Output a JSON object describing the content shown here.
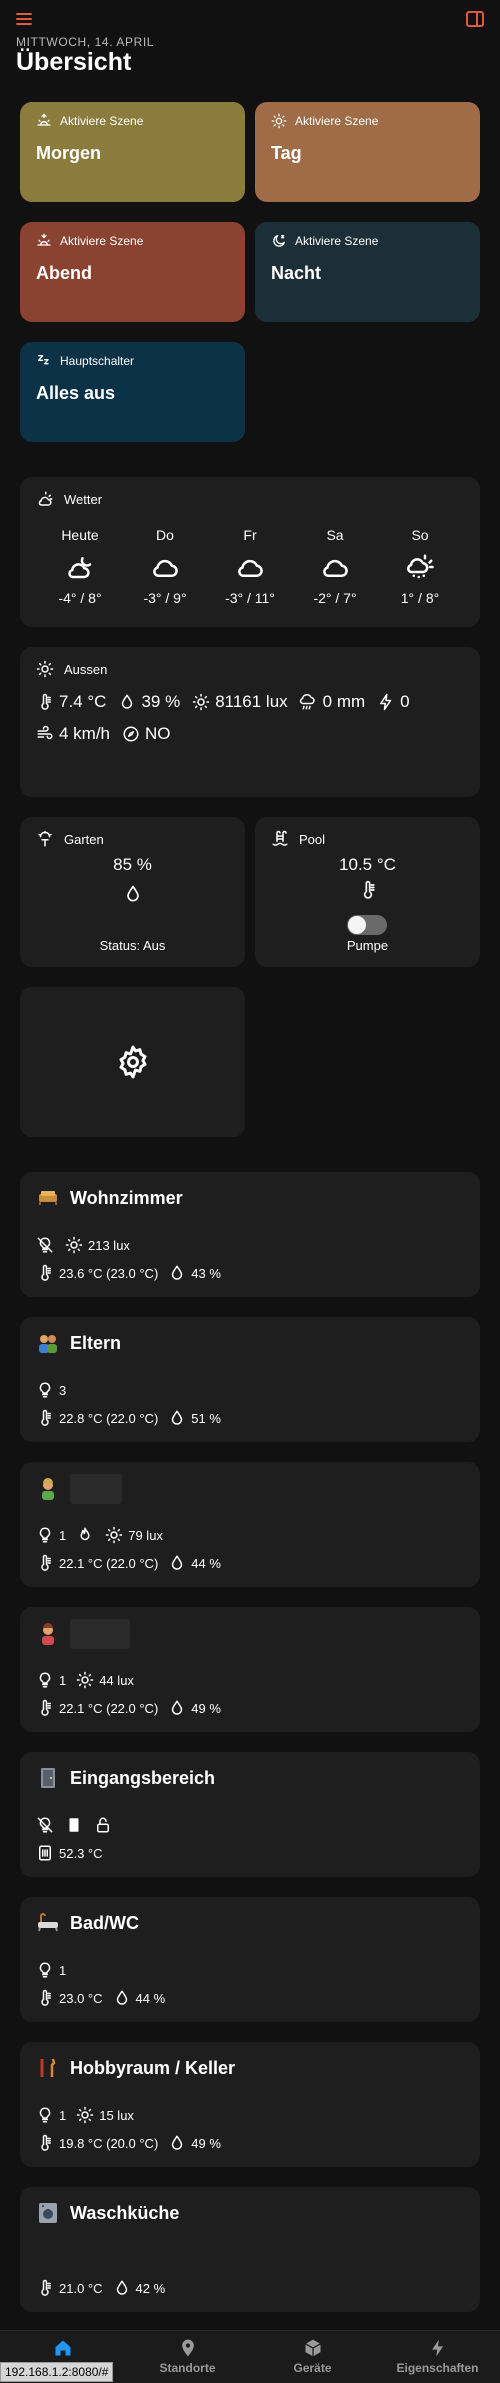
{
  "header": {
    "date": "Mittwoch, 14. April",
    "title": "Übersicht"
  },
  "scenes": [
    {
      "sub": "Aktiviere Szene",
      "label": "Morgen",
      "icon": "sunrise-icon",
      "color": "#8b7b3d"
    },
    {
      "sub": "Aktiviere Szene",
      "label": "Tag",
      "icon": "sun-icon",
      "color": "#a06c47"
    },
    {
      "sub": "Aktiviere Szene",
      "label": "Abend",
      "icon": "sunset-icon",
      "color": "#8a4331"
    },
    {
      "sub": "Aktiviere Szene",
      "label": "Nacht",
      "icon": "moon-icon",
      "color": "#1c2f38"
    },
    {
      "sub": "Hauptschalter",
      "label": "Alles aus",
      "icon": "sleep-icon",
      "color": "#0c3248"
    }
  ],
  "weather": {
    "title": "Wetter",
    "days": [
      {
        "name": "Heute",
        "temp": "-4° / 8°",
        "icon": "partly-cloudy-night-icon"
      },
      {
        "name": "Do",
        "temp": "-3° / 9°",
        "icon": "cloud-icon"
      },
      {
        "name": "Fr",
        "temp": "-3° / 11°",
        "icon": "cloud-icon"
      },
      {
        "name": "Sa",
        "temp": "-2° / 7°",
        "icon": "cloud-icon"
      },
      {
        "name": "So",
        "temp": "1° / 8°",
        "icon": "partly-cloudy-snow-icon"
      }
    ]
  },
  "aussen": {
    "title": "Aussen",
    "temp": "7.4 °C",
    "humidity": "39 %",
    "lux": "81161 lux",
    "rain": "0 mm",
    "lightning": "0",
    "wind": "4 km/h",
    "direction": "NO"
  },
  "garten": {
    "title": "Garten",
    "value": "85 %",
    "status": "Status: Aus"
  },
  "pool": {
    "title": "Pool",
    "value": "10.5 °C",
    "switch_label": "Pumpe"
  },
  "rooms": {
    "wohnzimmer": {
      "name": "Wohnzimmer",
      "lux": "213 lux",
      "temp": "23.6 °C (23.0 °C)",
      "hum": "43 %"
    },
    "eltern": {
      "name": "Eltern",
      "lights": "3",
      "temp": "22.8 °C (22.0 °C)",
      "hum": "51 %"
    },
    "kind1": {
      "lights": "1",
      "lux": "79 lux",
      "temp": "22.1 °C (22.0 °C)",
      "hum": "44 %"
    },
    "kind2": {
      "lights": "1",
      "lux": "44 lux",
      "temp": "22.1 °C (22.0 °C)",
      "hum": "49 %"
    },
    "eingang": {
      "name": "Eingangsbereich",
      "temp": "52.3 °C"
    },
    "bad": {
      "name": "Bad/WC",
      "lights": "1",
      "temp": "23.0 °C",
      "hum": "44 %"
    },
    "hobby": {
      "name": "Hobbyraum / Keller",
      "lights": "1",
      "lux": "15 lux",
      "temp": "19.8 °C (20.0 °C)",
      "hum": "49 %"
    },
    "wasch": {
      "name": "Waschküche",
      "temp": "21.0 °C",
      "hum": "42 %"
    }
  },
  "nav": {
    "item1": "",
    "item2": "Standorte",
    "item3": "Geräte",
    "item4": "Eigenschaften"
  },
  "status_url": "192.168.1.2:8080/#"
}
